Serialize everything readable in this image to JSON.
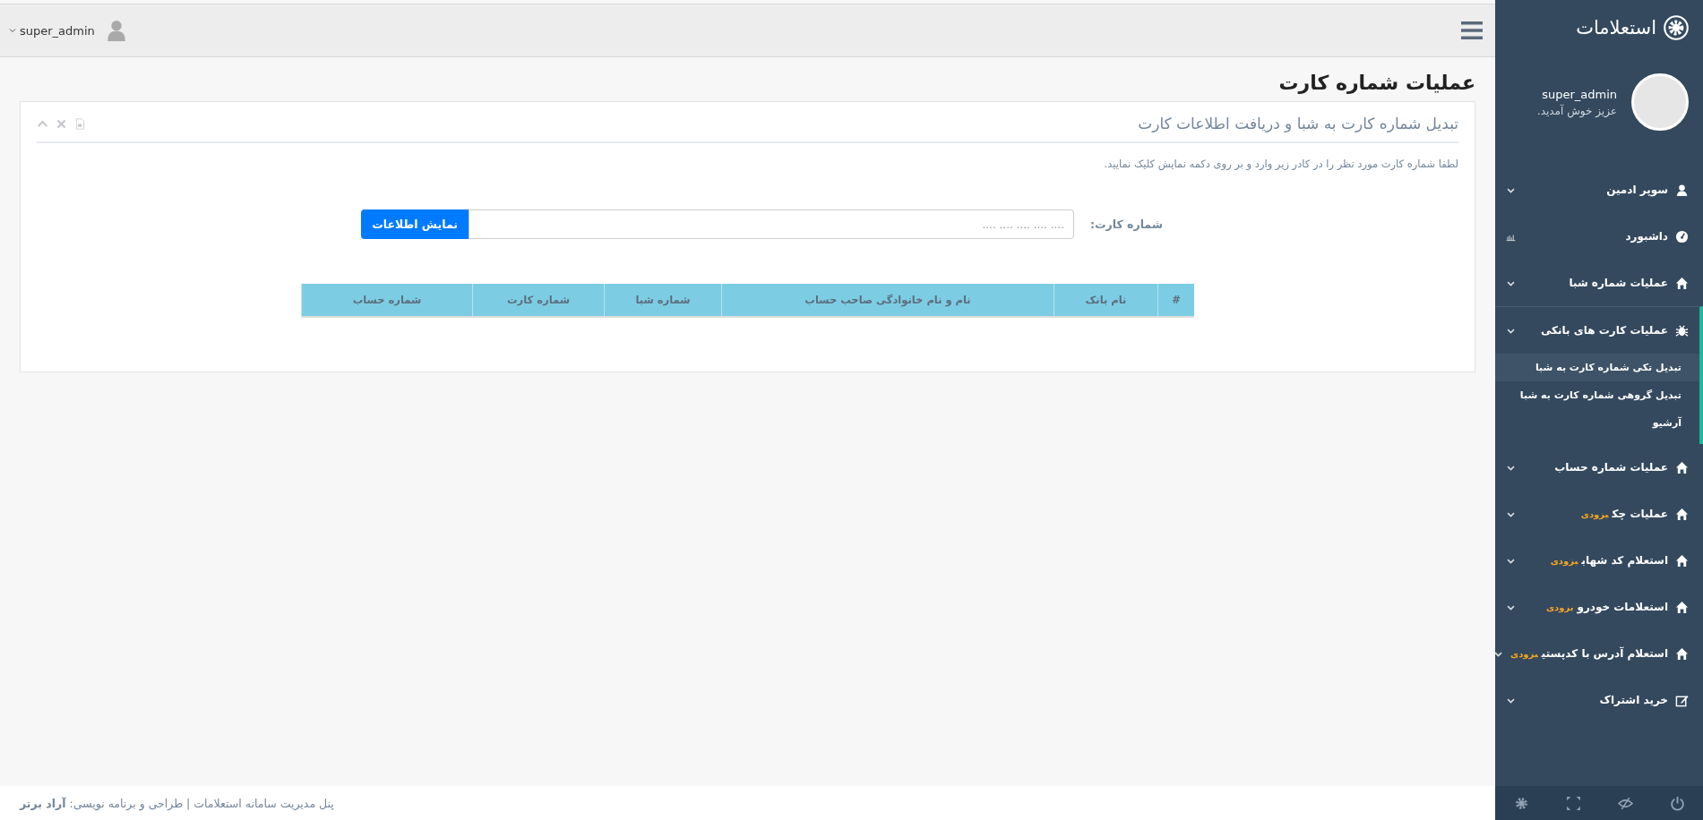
{
  "sidebar": {
    "title": "استعلامات",
    "user": {
      "name": "super_admin",
      "greeting": "عزیز خوش آمدید."
    },
    "menu": [
      {
        "label": "سوپر ادمین",
        "expanded": false
      },
      {
        "label": "داشبورد",
        "expanded": false
      },
      {
        "label": "عملیات شماره شبا",
        "expanded": false
      },
      {
        "label": "عملیات کارت های بانکی",
        "expanded": true,
        "children": [
          {
            "label": "تبدیل تکی شماره کارت به شبا",
            "selected": true
          },
          {
            "label": "تبدیل گروهی شماره کارت به شبا",
            "selected": false
          },
          {
            "label": "آرشیو",
            "selected": false
          }
        ]
      },
      {
        "label": "عملیات شماره حساب",
        "expanded": false
      },
      {
        "label": "عملیات چک",
        "badge": "بزودی",
        "expanded": false
      },
      {
        "label": "استعلام کد شهاب",
        "badge": "بزودی",
        "expanded": false
      },
      {
        "label": "استعلامات خودرو",
        "badge": "بزودی",
        "expanded": false
      },
      {
        "label": "استعلام آدرس با کدپستی",
        "badge": "بزودی",
        "expanded": false
      },
      {
        "label": "خرید اشتراک",
        "expanded": false
      }
    ]
  },
  "topbar": {
    "user": "super_admin"
  },
  "page_title": "عملیات شماره کارت",
  "card": {
    "title": "تبدیل شماره کارت به شبا و دریافت اطلاعات کارت",
    "instructions": "لطفا شماره کارت مورد نظر را در کادر زیر وارد و بر روی دکمه نمایش کلیک نمایید.",
    "field_label": "شماره کارت:",
    "placeholder": ".... .... .... .... ....",
    "button": "نمایش اطلاعات",
    "table": {
      "columns": [
        "#",
        "نام بانک",
        "نام و نام خانوادگی صاحب حساب",
        "شماره شبا",
        "شماره کارت",
        "شماره حساب"
      ]
    }
  },
  "footer": "پنل مدیریت سامانه استعلامات | طراحی و برنامه نویسی: **آراد برتر**"
}
